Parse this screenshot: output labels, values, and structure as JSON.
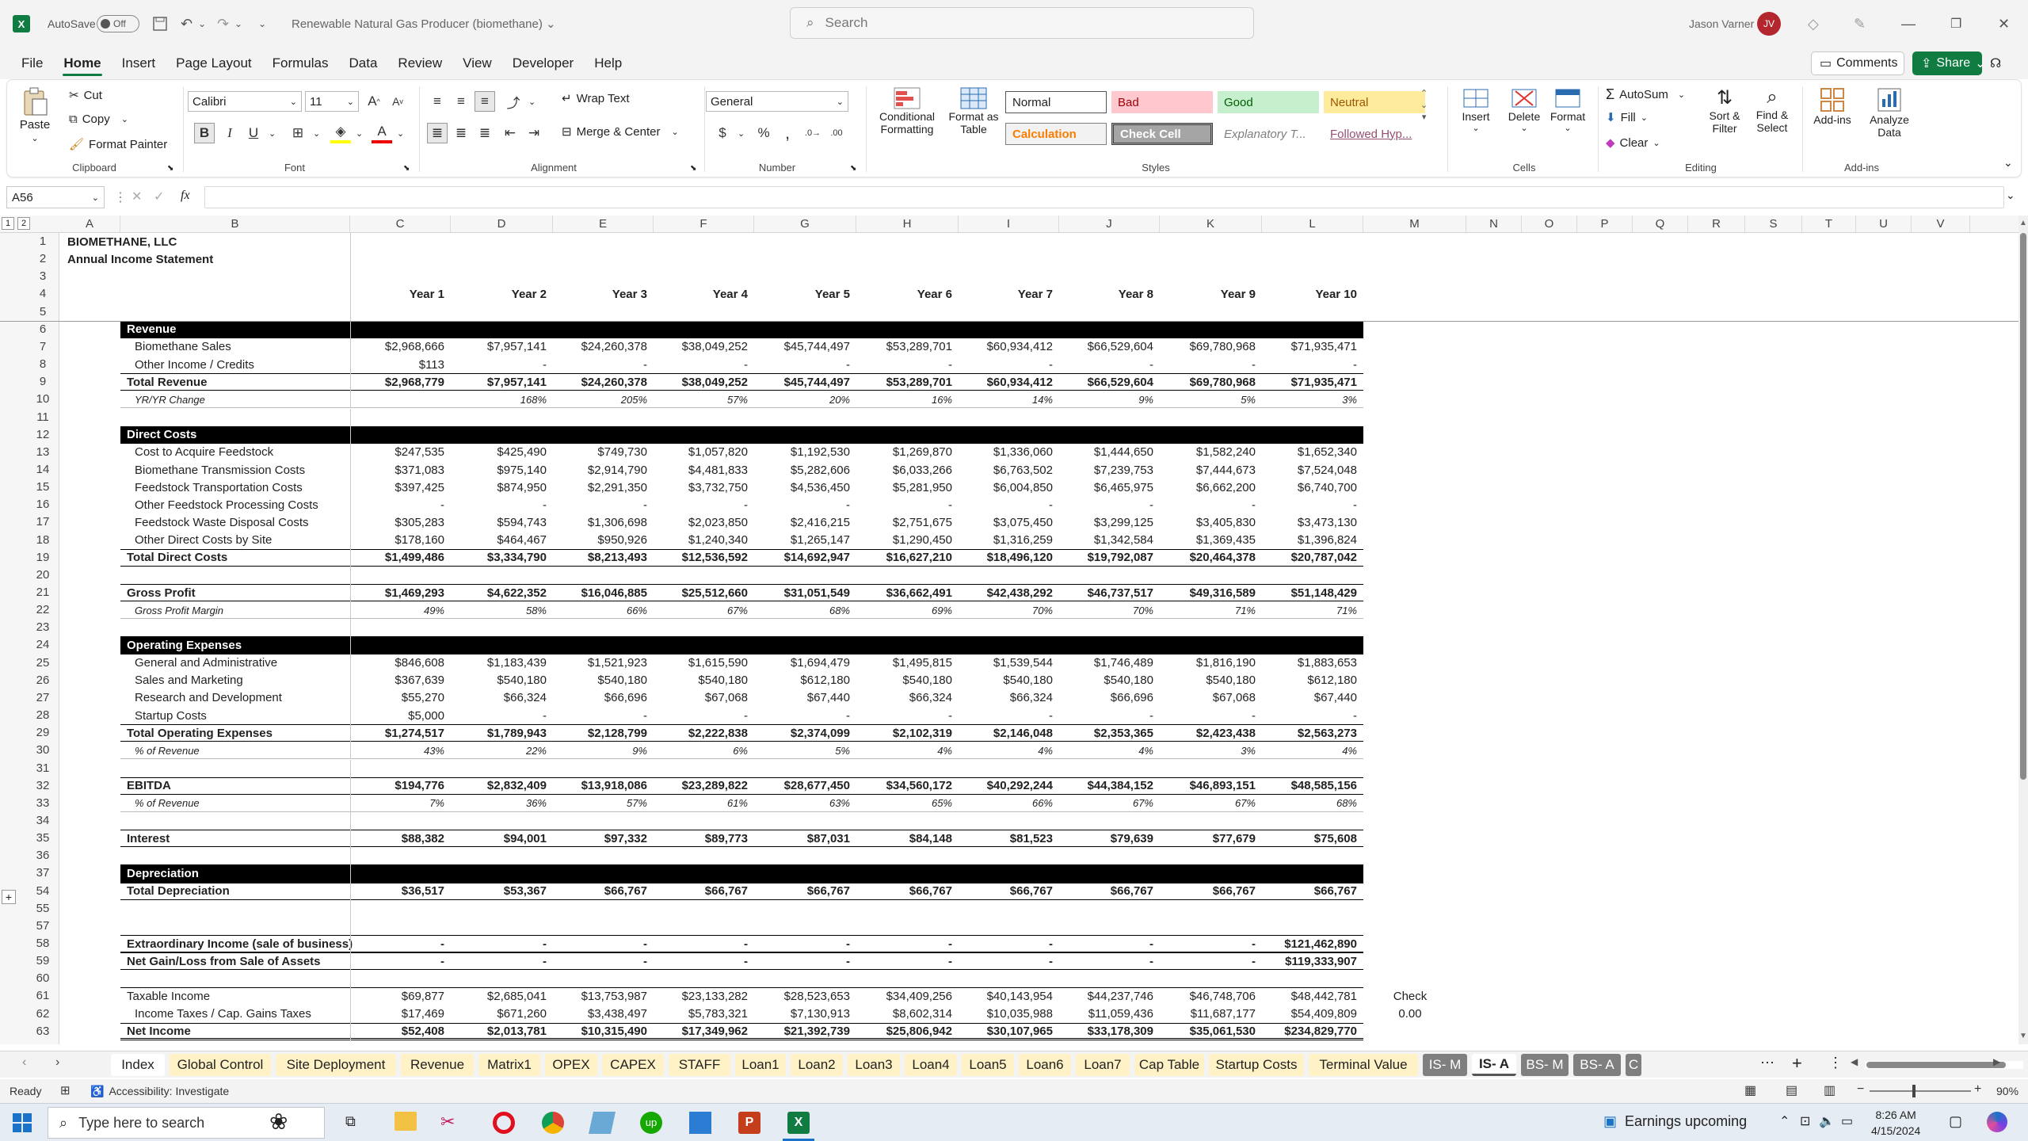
{
  "app": {
    "autosave_label": "AutoSave",
    "autosave_state": "Off",
    "doc_title": "Renewable Natural Gas Producer (biomethane)",
    "search_placeholder": "Search",
    "user_name": "Jason Varner",
    "user_initials": "JV"
  },
  "menu": {
    "items": [
      "File",
      "Home",
      "Insert",
      "Page Layout",
      "Formulas",
      "Data",
      "Review",
      "View",
      "Developer",
      "Help"
    ],
    "active": "Home",
    "comments_label": "Comments",
    "share_label": "Share"
  },
  "ribbon": {
    "clipboard": {
      "paste": "Paste",
      "cut": "Cut",
      "copy": "Copy",
      "format_painter": "Format Painter",
      "group": "Clipboard"
    },
    "font": {
      "name": "Calibri",
      "size": "11",
      "group": "Font"
    },
    "alignment": {
      "wrap": "Wrap Text",
      "merge": "Merge & Center",
      "group": "Alignment"
    },
    "number": {
      "format": "General",
      "group": "Number"
    },
    "styles": {
      "conditional": "Conditional Formatting",
      "format_table": "Format as Table",
      "cells": [
        {
          "label": "Normal",
          "bg": "#ffffff",
          "fg": "#000000"
        },
        {
          "label": "Bad",
          "bg": "#ffc7ce",
          "fg": "#9c0006"
        },
        {
          "label": "Good",
          "bg": "#c6efce",
          "fg": "#006100"
        },
        {
          "label": "Neutral",
          "bg": "#ffeb9c",
          "fg": "#9c5700"
        },
        {
          "label": "Calculation",
          "bg": "#f2f2f2",
          "fg": "#fa7d00"
        },
        {
          "label": "Check Cell",
          "bg": "#a5a5a5",
          "fg": "#ffffff"
        },
        {
          "label": "Explanatory T...",
          "bg": "#ffffff",
          "fg": "#7f7f7f"
        },
        {
          "label": "Followed Hyp...",
          "bg": "#ffffff",
          "fg": "#954f72"
        }
      ],
      "group": "Styles"
    },
    "cells": {
      "insert": "Insert",
      "delete": "Delete",
      "format": "Format",
      "group": "Cells"
    },
    "editing": {
      "autosum": "AutoSum",
      "fill": "Fill",
      "clear": "Clear",
      "sort": "Sort & Filter",
      "find": "Find & Select",
      "group": "Editing"
    },
    "addins": {
      "addins": "Add-ins",
      "analyze": "Analyze Data",
      "group": "Add-ins"
    }
  },
  "formula_bar": {
    "name_box": "A56",
    "fx": "fx",
    "content": ""
  },
  "columns": [
    "A",
    "B",
    "C",
    "D",
    "E",
    "F",
    "G",
    "H",
    "I",
    "J",
    "K",
    "L",
    "M",
    "N",
    "O",
    "P",
    "Q",
    "R",
    "S",
    "T",
    "U",
    "V"
  ],
  "sheet": {
    "title1": "BIOMETHANE, LLC",
    "title2": "Annual Income Statement",
    "years": [
      "Year 1",
      "Year 2",
      "Year 3",
      "Year 4",
      "Year 5",
      "Year 6",
      "Year 7",
      "Year 8",
      "Year 9",
      "Year 10"
    ],
    "rows": [
      {
        "n": "1",
        "type": "title",
        "label_key": "title1"
      },
      {
        "n": "2",
        "type": "title",
        "label_key": "title2"
      },
      {
        "n": "3",
        "type": "blank"
      },
      {
        "n": "4",
        "type": "years"
      },
      {
        "n": "5",
        "type": "blank"
      },
      {
        "n": "6",
        "type": "header",
        "label": "Revenue"
      },
      {
        "n": "7",
        "type": "line",
        "label": "Biomethane Sales",
        "v": [
          "$2,968,666",
          "$7,957,141",
          "$24,260,378",
          "$38,049,252",
          "$45,744,497",
          "$53,289,701",
          "$60,934,412",
          "$66,529,604",
          "$69,780,968",
          "$71,935,471"
        ]
      },
      {
        "n": "8",
        "type": "line",
        "label": "Other Income / Credits",
        "v": [
          "$113",
          "-",
          "-",
          "-",
          "-",
          "-",
          "-",
          "-",
          "-",
          "-"
        ]
      },
      {
        "n": "9",
        "type": "total",
        "label": "Total Revenue",
        "v": [
          "$2,968,779",
          "$7,957,141",
          "$24,260,378",
          "$38,049,252",
          "$45,744,497",
          "$53,289,701",
          "$60,934,412",
          "$66,529,604",
          "$69,780,968",
          "$71,935,471"
        ]
      },
      {
        "n": "10",
        "type": "pct",
        "label": "YR/YR Change",
        "v": [
          "",
          "168%",
          "205%",
          "57%",
          "20%",
          "16%",
          "14%",
          "9%",
          "5%",
          "3%"
        ]
      },
      {
        "n": "11",
        "type": "blank"
      },
      {
        "n": "12",
        "type": "header",
        "label": "Direct Costs"
      },
      {
        "n": "13",
        "type": "line",
        "label": "Cost to Acquire Feedstock",
        "v": [
          "$247,535",
          "$425,490",
          "$749,730",
          "$1,057,820",
          "$1,192,530",
          "$1,269,870",
          "$1,336,060",
          "$1,444,650",
          "$1,582,240",
          "$1,652,340"
        ]
      },
      {
        "n": "14",
        "type": "line",
        "label": "Biomethane Transmission Costs",
        "v": [
          "$371,083",
          "$975,140",
          "$2,914,790",
          "$4,481,833",
          "$5,282,606",
          "$6,033,266",
          "$6,763,502",
          "$7,239,753",
          "$7,444,673",
          "$7,524,048"
        ]
      },
      {
        "n": "15",
        "type": "line",
        "label": "Feedstock Transportation Costs",
        "v": [
          "$397,425",
          "$874,950",
          "$2,291,350",
          "$3,732,750",
          "$4,536,450",
          "$5,281,950",
          "$6,004,850",
          "$6,465,975",
          "$6,662,200",
          "$6,740,700"
        ]
      },
      {
        "n": "16",
        "type": "line",
        "label": "Other Feedstock Processing Costs",
        "v": [
          "-",
          "-",
          "-",
          "-",
          "-",
          "-",
          "-",
          "-",
          "-",
          "-"
        ]
      },
      {
        "n": "17",
        "type": "line",
        "label": "Feedstock Waste Disposal Costs",
        "v": [
          "$305,283",
          "$594,743",
          "$1,306,698",
          "$2,023,850",
          "$2,416,215",
          "$2,751,675",
          "$3,075,450",
          "$3,299,125",
          "$3,405,830",
          "$3,473,130"
        ]
      },
      {
        "n": "18",
        "type": "line",
        "label": "Other Direct Costs by Site",
        "v": [
          "$178,160",
          "$464,467",
          "$950,926",
          "$1,240,340",
          "$1,265,147",
          "$1,290,450",
          "$1,316,259",
          "$1,342,584",
          "$1,369,435",
          "$1,396,824"
        ]
      },
      {
        "n": "19",
        "type": "total",
        "label": "Total Direct Costs",
        "v": [
          "$1,499,486",
          "$3,334,790",
          "$8,213,493",
          "$12,536,592",
          "$14,692,947",
          "$16,627,210",
          "$18,496,120",
          "$19,792,087",
          "$20,464,378",
          "$20,787,042"
        ]
      },
      {
        "n": "20",
        "type": "blank"
      },
      {
        "n": "21",
        "type": "boxed",
        "label": "Gross Profit",
        "v": [
          "$1,469,293",
          "$4,622,352",
          "$16,046,885",
          "$25,512,660",
          "$31,051,549",
          "$36,662,491",
          "$42,438,292",
          "$46,737,517",
          "$49,316,589",
          "$51,148,429"
        ]
      },
      {
        "n": "22",
        "type": "pct",
        "label": "Gross Profit Margin",
        "v": [
          "49%",
          "58%",
          "66%",
          "67%",
          "68%",
          "69%",
          "70%",
          "70%",
          "71%",
          "71%"
        ]
      },
      {
        "n": "23",
        "type": "blank"
      },
      {
        "n": "24",
        "type": "header",
        "label": "Operating Expenses"
      },
      {
        "n": "25",
        "type": "line",
        "label": "General and Administrative",
        "v": [
          "$846,608",
          "$1,183,439",
          "$1,521,923",
          "$1,615,590",
          "$1,694,479",
          "$1,495,815",
          "$1,539,544",
          "$1,746,489",
          "$1,816,190",
          "$1,883,653"
        ]
      },
      {
        "n": "26",
        "type": "line",
        "label": "Sales and Marketing",
        "v": [
          "$367,639",
          "$540,180",
          "$540,180",
          "$540,180",
          "$612,180",
          "$540,180",
          "$540,180",
          "$540,180",
          "$540,180",
          "$612,180"
        ]
      },
      {
        "n": "27",
        "type": "line",
        "label": "Research and Development",
        "v": [
          "$55,270",
          "$66,324",
          "$66,696",
          "$67,068",
          "$67,440",
          "$66,324",
          "$66,324",
          "$66,696",
          "$67,068",
          "$67,440"
        ]
      },
      {
        "n": "28",
        "type": "line",
        "label": "Startup Costs",
        "v": [
          "$5,000",
          "-",
          "-",
          "-",
          "-",
          "-",
          "-",
          "-",
          "-",
          "-"
        ]
      },
      {
        "n": "29",
        "type": "total",
        "label": "Total Operating Expenses",
        "v": [
          "$1,274,517",
          "$1,789,943",
          "$2,128,799",
          "$2,222,838",
          "$2,374,099",
          "$2,102,319",
          "$2,146,048",
          "$2,353,365",
          "$2,423,438",
          "$2,563,273"
        ]
      },
      {
        "n": "30",
        "type": "pct",
        "label": "% of Revenue",
        "v": [
          "43%",
          "22%",
          "9%",
          "6%",
          "5%",
          "4%",
          "4%",
          "4%",
          "3%",
          "4%"
        ]
      },
      {
        "n": "31",
        "type": "blank"
      },
      {
        "n": "32",
        "type": "boxed",
        "label": "EBITDA",
        "v": [
          "$194,776",
          "$2,832,409",
          "$13,918,086",
          "$23,289,822",
          "$28,677,450",
          "$34,560,172",
          "$40,292,244",
          "$44,384,152",
          "$46,893,151",
          "$48,585,156"
        ]
      },
      {
        "n": "33",
        "type": "pct",
        "label": "% of Revenue",
        "v": [
          "7%",
          "36%",
          "57%",
          "61%",
          "63%",
          "65%",
          "66%",
          "67%",
          "67%",
          "68%"
        ]
      },
      {
        "n": "34",
        "type": "blank"
      },
      {
        "n": "35",
        "type": "boxed",
        "label": "Interest",
        "v": [
          "$88,382",
          "$94,001",
          "$97,332",
          "$89,773",
          "$87,031",
          "$84,148",
          "$81,523",
          "$79,639",
          "$77,679",
          "$75,608"
        ]
      },
      {
        "n": "36",
        "type": "blank"
      },
      {
        "n": "37",
        "type": "header",
        "label": "Depreciation"
      },
      {
        "n": "54",
        "type": "total",
        "label": "Total Depreciation",
        "v": [
          "$36,517",
          "$53,367",
          "$66,767",
          "$66,767",
          "$66,767",
          "$66,767",
          "$66,767",
          "$66,767",
          "$66,767",
          "$66,767"
        ]
      },
      {
        "n": "55",
        "type": "blank"
      },
      {
        "n": "57",
        "type": "blank"
      },
      {
        "n": "58",
        "type": "boxed",
        "label": "Extraordinary Income (sale of business)",
        "v": [
          "-",
          "-",
          "-",
          "-",
          "-",
          "-",
          "-",
          "-",
          "-",
          "$121,462,890"
        ]
      },
      {
        "n": "59",
        "type": "boxed",
        "label": "Net Gain/Loss from Sale of Assets",
        "v": [
          "-",
          "-",
          "-",
          "-",
          "-",
          "-",
          "-",
          "-",
          "-",
          "$119,333,907"
        ]
      },
      {
        "n": "60",
        "type": "blank"
      },
      {
        "n": "61",
        "type": "taxable",
        "label": "Taxable Income",
        "v": [
          "$69,877",
          "$2,685,041",
          "$13,753,987",
          "$23,133,282",
          "$28,523,653",
          "$34,409,256",
          "$40,143,954",
          "$44,237,746",
          "$46,748,706",
          "$48,442,781"
        ],
        "extra": "Check"
      },
      {
        "n": "62",
        "type": "line",
        "label": "Income Taxes / Cap. Gains Taxes",
        "v": [
          "$17,469",
          "$671,260",
          "$3,438,497",
          "$5,783,321",
          "$7,130,913",
          "$8,602,314",
          "$10,035,988",
          "$11,059,436",
          "$11,687,177",
          "$54,409,809"
        ],
        "extra": "0.00"
      },
      {
        "n": "63",
        "type": "net",
        "label": "Net Income",
        "v": [
          "$52,408",
          "$2,013,781",
          "$10,315,490",
          "$17,349,962",
          "$21,392,739",
          "$25,806,942",
          "$30,107,965",
          "$33,178,309",
          "$35,061,530",
          "$234,829,770"
        ]
      }
    ]
  },
  "tabs": [
    {
      "label": "Index",
      "style": "active-plain"
    },
    {
      "label": "Global Control",
      "style": "yellow"
    },
    {
      "label": "Site Deployment",
      "style": "yellow"
    },
    {
      "label": "Revenue",
      "style": "yellow"
    },
    {
      "label": "Matrix1",
      "style": "yellow"
    },
    {
      "label": "OPEX",
      "style": "yellow"
    },
    {
      "label": "CAPEX",
      "style": "yellow"
    },
    {
      "label": "STAFF",
      "style": "yellow"
    },
    {
      "label": "Loan1",
      "style": "yellow"
    },
    {
      "label": "Loan2",
      "style": "yellow"
    },
    {
      "label": "Loan3",
      "style": "yellow"
    },
    {
      "label": "Loan4",
      "style": "yellow"
    },
    {
      "label": "Loan5",
      "style": "yellow"
    },
    {
      "label": "Loan6",
      "style": "yellow"
    },
    {
      "label": "Loan7",
      "style": "yellow"
    },
    {
      "label": "Cap Table",
      "style": "yellow"
    },
    {
      "label": "Startup Costs",
      "style": "yellow"
    },
    {
      "label": "Terminal Value",
      "style": "yellow"
    },
    {
      "label": "IS- M",
      "style": "gray"
    },
    {
      "label": "IS- A",
      "style": "selected"
    },
    {
      "label": "BS- M",
      "style": "gray"
    },
    {
      "label": "BS- A",
      "style": "gray"
    },
    {
      "label": "C",
      "style": "gray"
    }
  ],
  "status": {
    "ready": "Ready",
    "accessibility": "Accessibility: Investigate",
    "zoom": "90%"
  },
  "taskbar": {
    "search_placeholder": "Type here to search",
    "news": "Earnings upcoming",
    "time": "8:26 AM",
    "date": "4/15/2024"
  }
}
